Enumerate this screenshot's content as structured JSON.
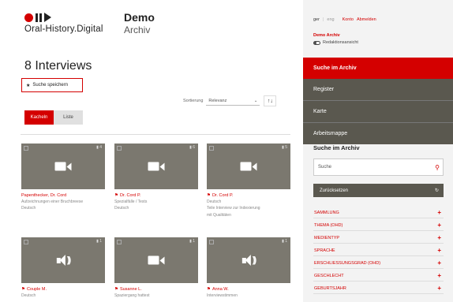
{
  "brand": {
    "logo_text": "Oral-History.Digital",
    "name": "Demo",
    "subtitle": "Archiv"
  },
  "main": {
    "title": "8 Interviews",
    "save_search_label": "Suche speichern",
    "sort": {
      "label": "Sortierung",
      "value": "Relevanz",
      "direction_label": "↑↓"
    },
    "view": {
      "tiles_label": "Kacheln",
      "list_label": "Liste"
    },
    "cards": [
      {
        "title": "Papenthecker, Dr. Cord",
        "line1": "Aufzeichnungen einer Bruchbreese",
        "line2": "Deutsch",
        "line3": "",
        "count": "▮ 4",
        "media": "video-camera-icon",
        "prefix": ""
      },
      {
        "title": "Dr. Cord P.",
        "line1": "Spezialfälle / Tests",
        "line2": "Deutsch",
        "line3": "",
        "count": "▮ 6",
        "media": "video-camera-icon",
        "prefix": "⚑"
      },
      {
        "title": "Dr. Cord P.",
        "line1": "Deutsch",
        "line2": "Teile Interview zur Indexierung",
        "line3": "mit Qualitäten",
        "count": "▮ 5",
        "media": "video-camera-icon",
        "prefix": "⚑"
      },
      {
        "title": "Couple M.",
        "line1": "Deutsch",
        "line2": "",
        "line3": "",
        "count": "▮ 1",
        "media": "audio-speaker-icon",
        "prefix": "⚑"
      },
      {
        "title": "Susanne L.",
        "line1": "Spaziergang hattest",
        "line2": "",
        "line3": "",
        "count": "▮ 1",
        "media": "video-camera-icon",
        "prefix": "⚑"
      },
      {
        "title": "Anna W.",
        "line1": "Interviewstimmen",
        "line2": "",
        "line3": "",
        "count": "▮ 1",
        "media": "audio-speaker-icon",
        "prefix": "⚑"
      }
    ]
  },
  "sidebar": {
    "lang_active": "ger",
    "lang_other": "eng",
    "links": [
      "Konto",
      "Abmelden"
    ],
    "archive_name": "Demo Archiv",
    "edit_view_label": "Redaktionsansicht",
    "nav": [
      "Suche im Archiv",
      "Register",
      "Karte",
      "Arbeitsmappe"
    ],
    "search_heading": "Suche im Archiv",
    "search_placeholder": "Suche",
    "reset_label": "Zurücksetzen",
    "facets": [
      "SAMMLUNG",
      "THEMA (OHD)",
      "MEDIENTYP",
      "SPRACHE",
      "ERSCHLIESSUNGSGRAD (OHD)",
      "GESCHLECHT",
      "GEBURTSJAHR"
    ]
  },
  "colors": {
    "accent": "#d40000",
    "dark_nav": "#5a584f",
    "thumb": "#7b786f"
  }
}
